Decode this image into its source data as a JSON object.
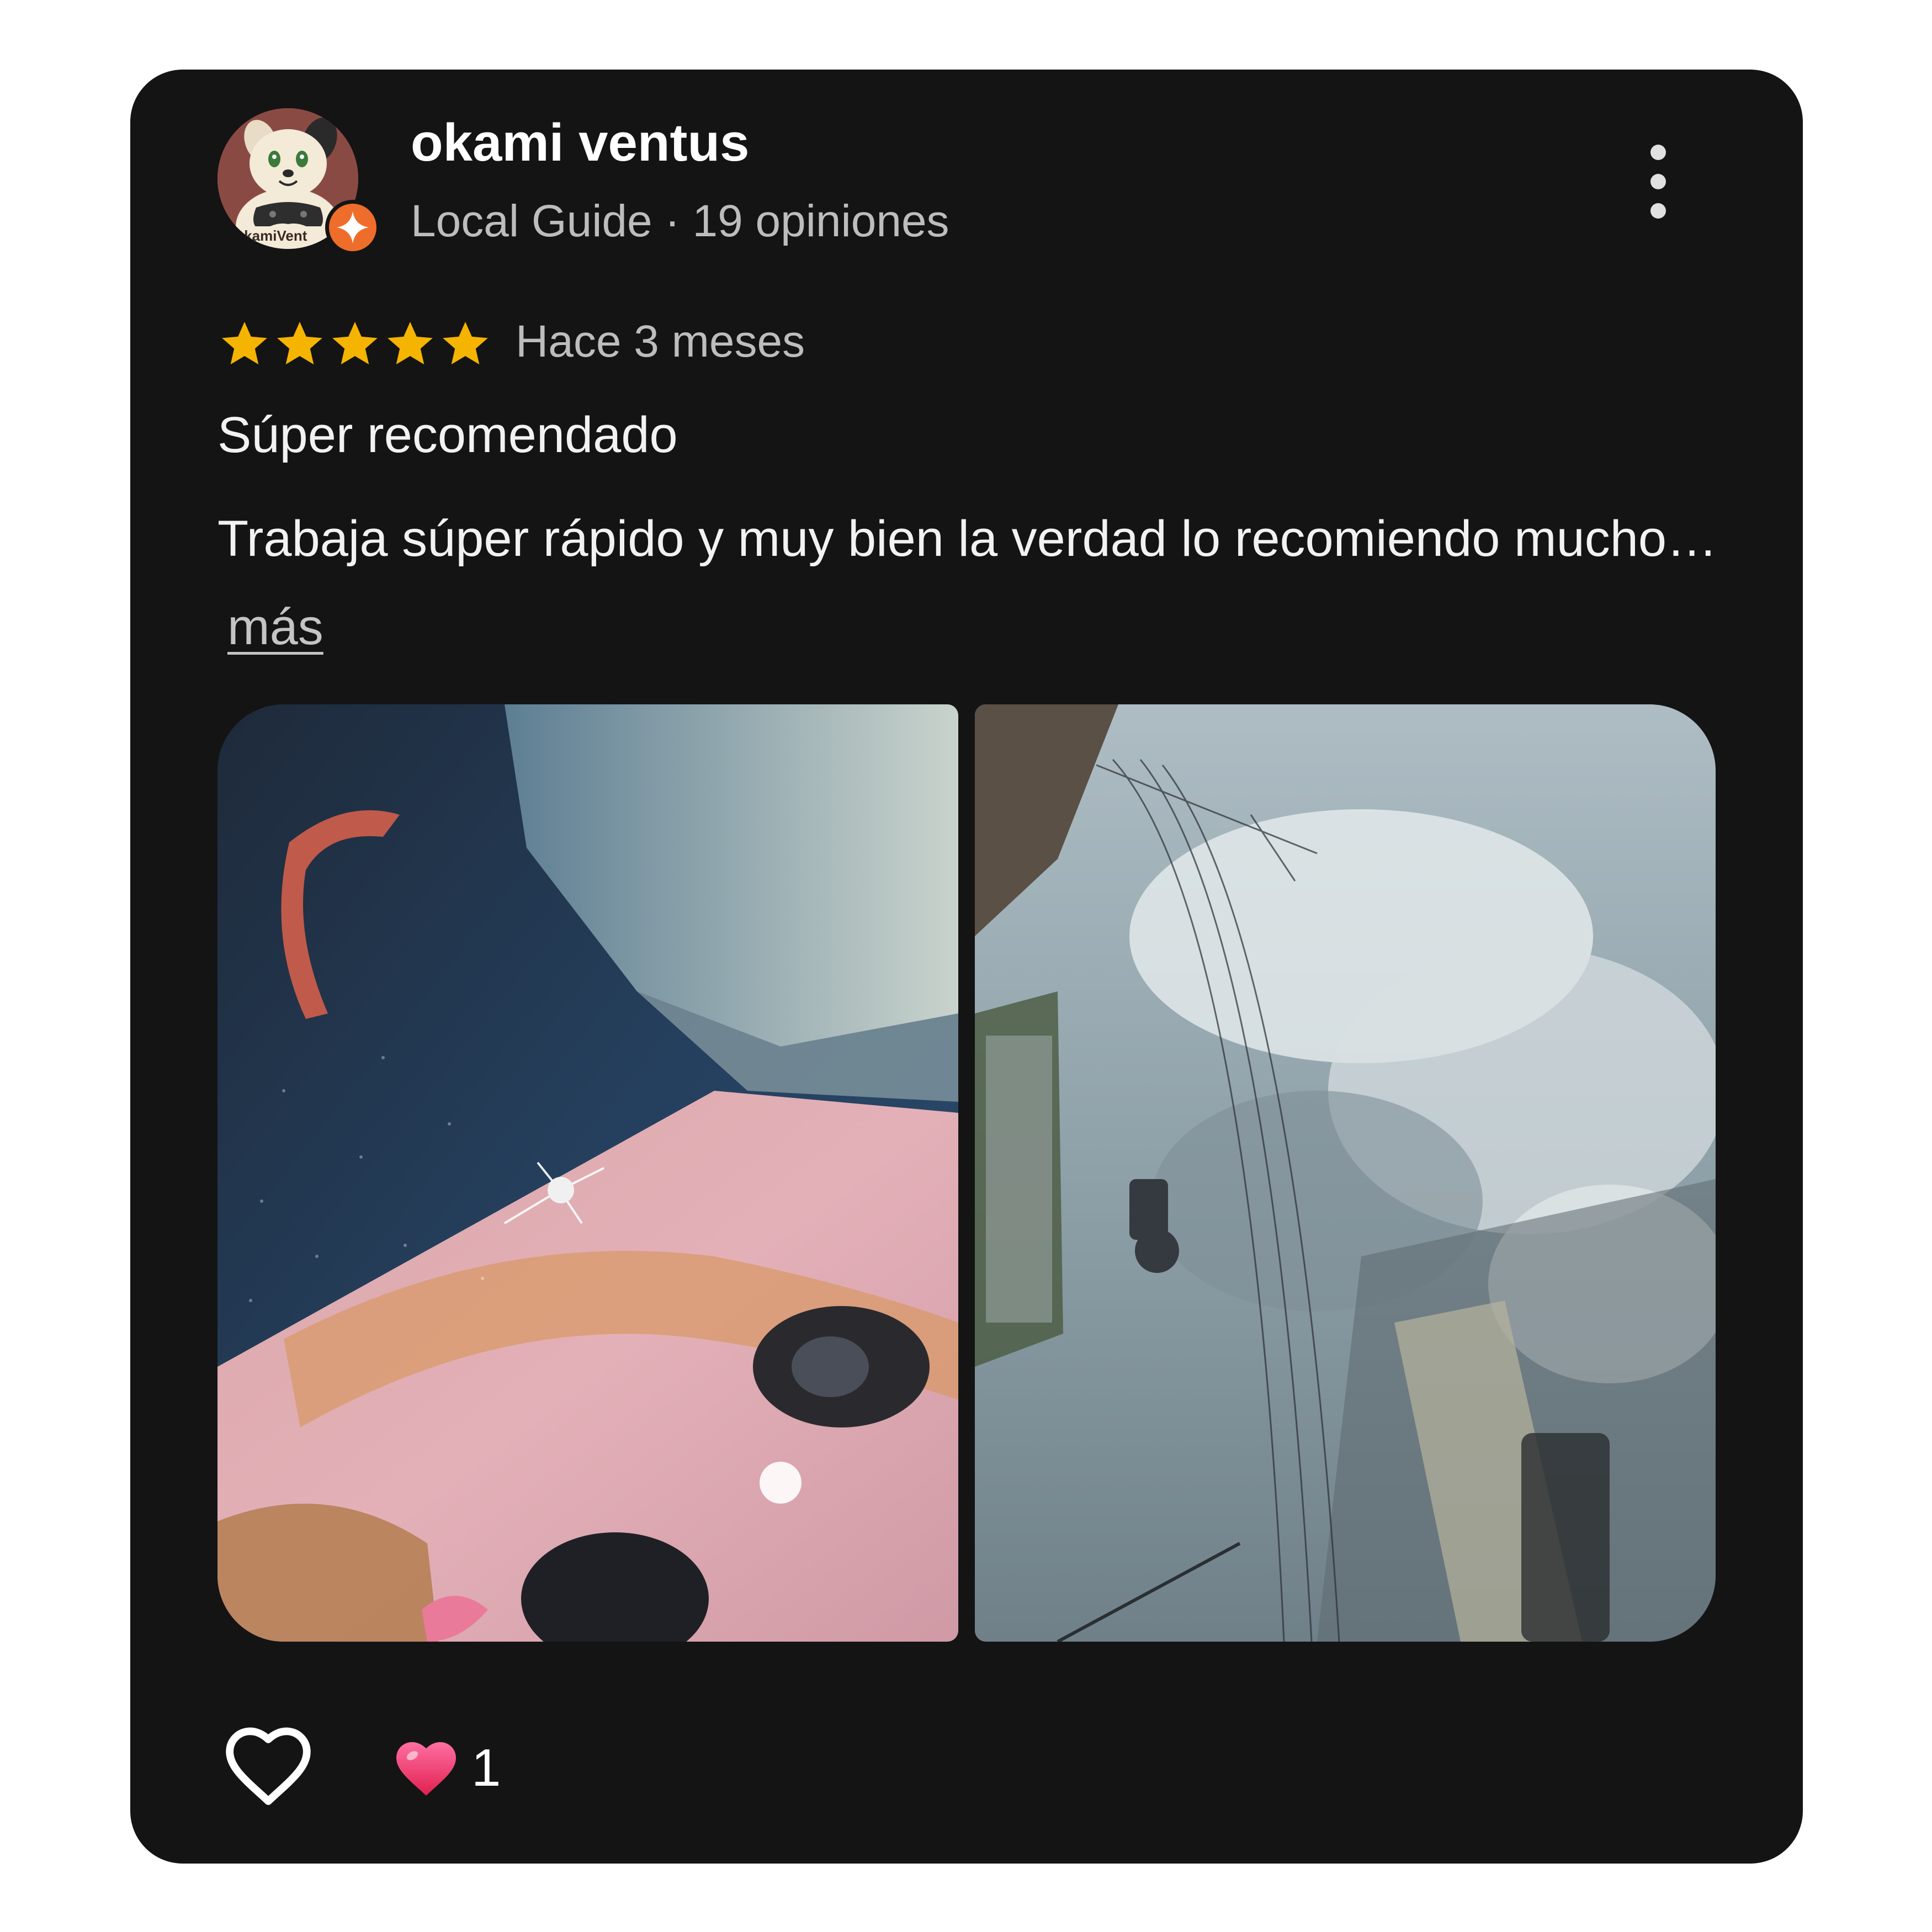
{
  "review": {
    "user_name": "okami ventus",
    "user_meta": "Local Guide · 19 opiniones",
    "avatar_text": "OkamiVent",
    "rating": 5,
    "rating_max": 5,
    "time_ago": "Hace 3 meses",
    "title": "Súper recomendado",
    "body": "Trabaja súper rápido y muy bien la verdad lo recomiendo mucho…",
    "more_label": "más",
    "photos": [
      {
        "name": "windshield-chip-closeup-photo",
        "icon": "photo"
      },
      {
        "name": "windshield-reflection-photo",
        "icon": "photo"
      }
    ],
    "reaction_count": "1",
    "reaction_icon": "heart-emoji",
    "like_icon": "heart-outline-icon"
  },
  "colors": {
    "card_background": "#141414",
    "star": "#f5b400",
    "badge": "#ee6d2b",
    "secondary_text": "#bdbdbd"
  }
}
